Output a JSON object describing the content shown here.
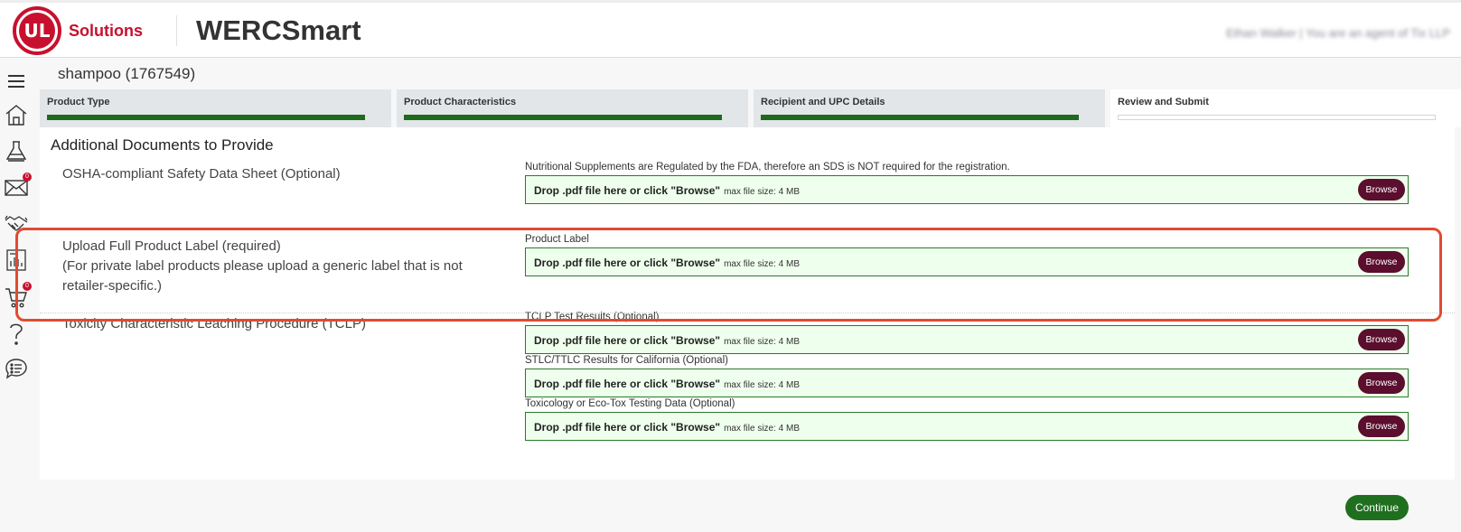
{
  "header": {
    "logo_mark": "UL",
    "logo_text": "Solutions",
    "app_title": "WERCSmart",
    "user_info": "Ethan Walker | You are an agent of Tix LLP"
  },
  "sidebar": {
    "items": [
      {
        "icon": "menu-icon"
      },
      {
        "icon": "home-icon"
      },
      {
        "icon": "flask-icon"
      },
      {
        "icon": "mail-icon",
        "badge": "0"
      },
      {
        "icon": "handshake-icon"
      },
      {
        "icon": "report-icon"
      },
      {
        "icon": "cart-icon",
        "badge": "0"
      },
      {
        "icon": "help-icon"
      },
      {
        "icon": "chat-icon"
      }
    ]
  },
  "product": {
    "title": "shampoo (1767549)"
  },
  "steps": [
    {
      "label": "Product Type",
      "progress": 1
    },
    {
      "label": "Product Characteristics",
      "progress": 1
    },
    {
      "label": "Recipient and UPC Details",
      "progress": 1
    },
    {
      "label": "Review and Submit",
      "progress": 0
    }
  ],
  "documents": {
    "section_title": "Additional Documents to Provide",
    "rows": [
      {
        "label_lines": [
          "OSHA-compliant Safety Data Sheet (Optional)"
        ],
        "fields": [
          {
            "caption": "Nutritional Supplements are Regulated by the FDA, therefore an SDS is NOT required for the registration.",
            "drop_text": "Drop .pdf file here or click \"Browse\"",
            "size_text": "max file size: 4 MB",
            "button": "Browse"
          }
        ]
      },
      {
        "label_lines": [
          "Upload Full Product Label (required)",
          "(For private label products please upload a generic label that is not",
          "retailer-specific.)"
        ],
        "fields": [
          {
            "caption": "Product Label",
            "drop_text": "Drop .pdf file here or click \"Browse\"",
            "size_text": "max file size: 4 MB",
            "button": "Browse"
          }
        ]
      },
      {
        "label_lines": [
          "Toxicity Characteristic Leaching Procedure (TCLP)"
        ],
        "fields": [
          {
            "caption": "TCLP Test Results (Optional)",
            "drop_text": "Drop .pdf file here or click \"Browse\"",
            "size_text": "max file size: 4 MB",
            "button": "Browse"
          },
          {
            "caption": "STLC/TTLC Results for California (Optional)",
            "drop_text": "Drop .pdf file here or click \"Browse\"",
            "size_text": "max file size: 4 MB",
            "button": "Browse"
          },
          {
            "caption": "Toxicology or Eco-Tox Testing Data (Optional)",
            "drop_text": "Drop .pdf file here or click \"Browse\"",
            "size_text": "max file size: 4 MB",
            "button": "Browse"
          }
        ]
      }
    ]
  },
  "footer": {
    "continue_label": "Continue"
  },
  "colors": {
    "brand_red": "#c8102e",
    "progress_green": "#1e6b1e",
    "browse_maroon": "#5b0e2d",
    "highlight": "#e04b30"
  }
}
